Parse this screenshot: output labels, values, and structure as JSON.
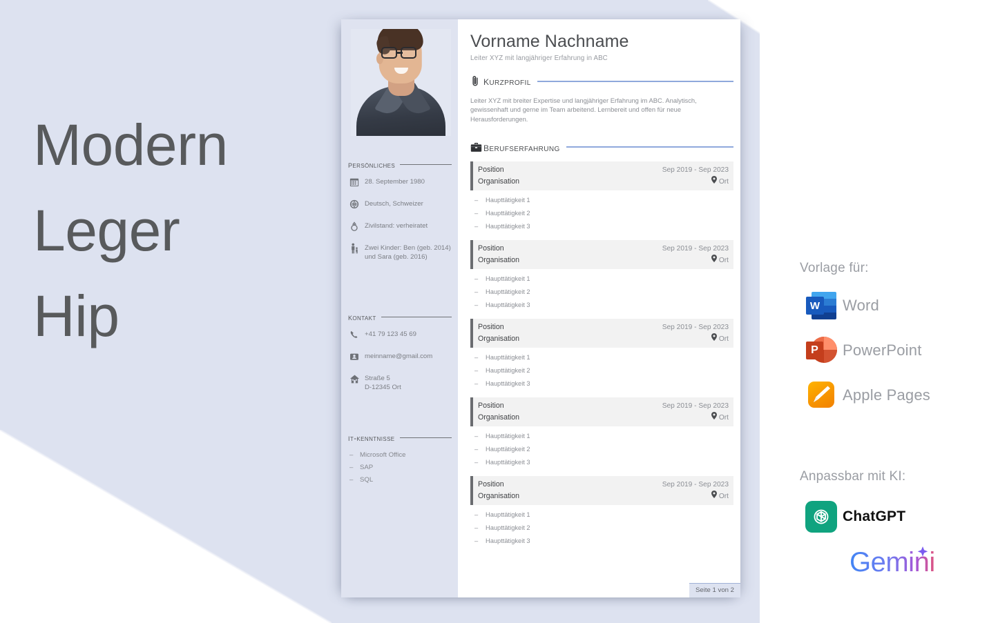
{
  "headline": {
    "lines": [
      "Modern",
      "Leger",
      "Hip"
    ]
  },
  "colors": {
    "background": "#dde2f0",
    "accent_rule": "#8fa8dc",
    "sidebar": "#dfe3f0",
    "heading_text": "#4b4d50",
    "body_text": "#8b8e94"
  },
  "resume": {
    "photo": {
      "alt": "portrait-photo"
    },
    "name": "Vorname Nachname",
    "tagline": "Leiter XYZ mit langjähriger Erfahrung in ABC",
    "sections": {
      "kurzprofil": {
        "icon": "paperclip-icon",
        "title": "Kurzprofil",
        "text": "Leiter XYZ mit breiter Expertise und langjähriger Erfahrung im ABC. Analytisch, gewissenhaft und gerne im Team arbeitend. Lernbereit und offen für neue Herausforderungen."
      },
      "berufserfahrung": {
        "icon": "briefcase-icon",
        "title": "Berufserfahrung",
        "entries": [
          {
            "position": "Position",
            "organisation": "Organisation",
            "dates": "Sep 2019 - Sep 2023",
            "location": "Ort",
            "tasks": [
              "Haupttätigkeit 1",
              "Haupttätigkeit 2",
              "Haupttätigkeit 3"
            ]
          },
          {
            "position": "Position",
            "organisation": "Organisation",
            "dates": "Sep 2019 - Sep 2023",
            "location": "Ort",
            "tasks": [
              "Haupttätigkeit 1",
              "Haupttätigkeit 2",
              "Haupttätigkeit 3"
            ]
          },
          {
            "position": "Position",
            "organisation": "Organisation",
            "dates": "Sep 2019 - Sep 2023",
            "location": "Ort",
            "tasks": [
              "Haupttätigkeit 1",
              "Haupttätigkeit 2",
              "Haupttätigkeit 3"
            ]
          },
          {
            "position": "Position",
            "organisation": "Organisation",
            "dates": "Sep 2019 - Sep 2023",
            "location": "Ort",
            "tasks": [
              "Haupttätigkeit 1",
              "Haupttätigkeit 2",
              "Haupttätigkeit 3"
            ]
          },
          {
            "position": "Position",
            "organisation": "Organisation",
            "dates": "Sep 2019 - Sep 2023",
            "location": "Ort",
            "tasks": [
              "Haupttätigkeit 1",
              "Haupttätigkeit 2",
              "Haupttätigkeit 3"
            ]
          }
        ]
      }
    },
    "sidebar": {
      "persoenliches": {
        "title": "Persönliches",
        "rows": [
          {
            "icon": "calendar-icon",
            "text": "28. September 1980"
          },
          {
            "icon": "globe-icon",
            "text": "Deutsch, Schweizer"
          },
          {
            "icon": "ring-icon",
            "text": "Zivilstand: verheiratet"
          },
          {
            "icon": "family-icon",
            "text": "Zwei Kinder: Ben (geb. 2014) und Sara (geb. 2016)"
          }
        ]
      },
      "kontakt": {
        "title": "Kontakt",
        "rows": [
          {
            "icon": "phone-icon",
            "text": "+41 79 123 45 69"
          },
          {
            "icon": "mail-icon",
            "text": "meinname@gmail.com"
          },
          {
            "icon": "home-icon",
            "text": "Straße 5\nD-12345 Ort"
          }
        ]
      },
      "it_kenntnisse": {
        "title": "IT-Kenntnisse",
        "items": [
          "Microsoft Office",
          "SAP",
          "SQL"
        ]
      }
    },
    "page_badge": "Seite 1 von 2"
  },
  "info_panel": {
    "template_title": "Vorlage für:",
    "apps": [
      {
        "icon": "word-icon",
        "name": "Word"
      },
      {
        "icon": "powerpoint-icon",
        "name": "PowerPoint"
      },
      {
        "icon": "apple-pages-icon",
        "name": "Apple Pages"
      }
    ],
    "ai_title": "Anpassbar mit KI:",
    "ai_tools": [
      {
        "icon": "chatgpt-icon",
        "name": "ChatGPT"
      },
      {
        "icon": "gemini-icon",
        "name": "Gemini"
      }
    ]
  }
}
